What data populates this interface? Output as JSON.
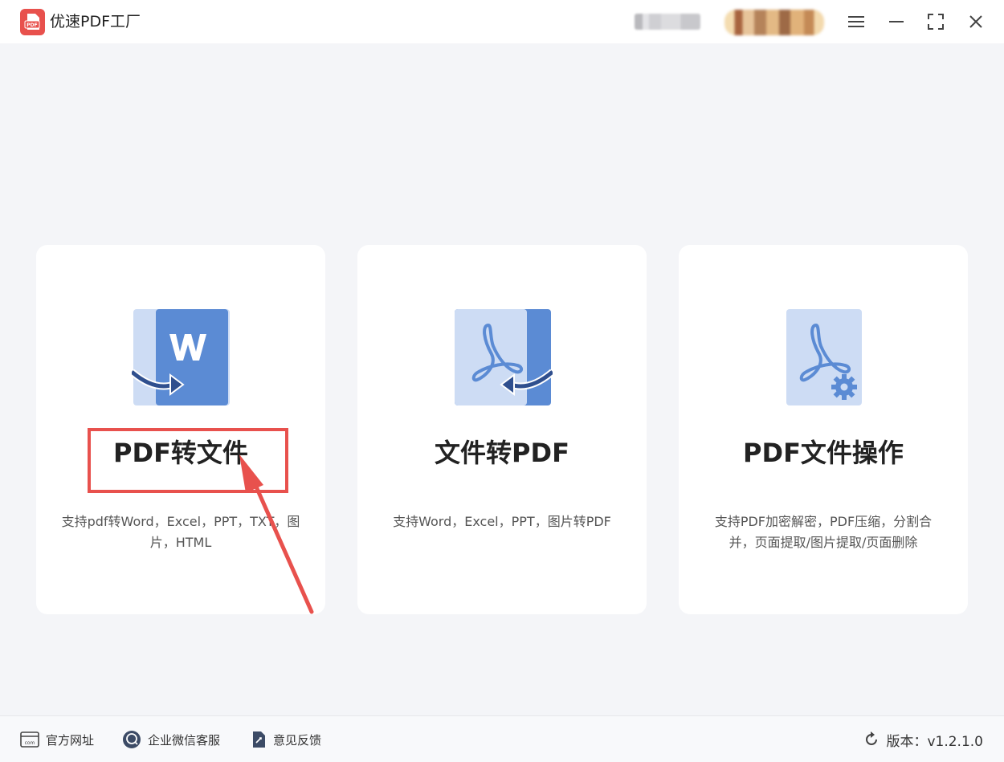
{
  "app": {
    "title": "优速PDF工厂",
    "logo_text": "PDF"
  },
  "cards": [
    {
      "title": "PDF转文件",
      "description": "支持pdf转Word，Excel，PPT，TXT，图片，HTML",
      "icon": "word-convert-icon"
    },
    {
      "title": "文件转PDF",
      "description": "支持Word，Excel，PPT，图片转PDF",
      "icon": "pdf-convert-icon"
    },
    {
      "title": "PDF文件操作",
      "description": "支持PDF加密解密，PDF压缩，分割合并，页面提取/图片提取/页面删除",
      "icon": "pdf-settings-icon"
    }
  ],
  "footer": {
    "website_label": "官方网址",
    "website_icon_text": "com",
    "wechat_label": "企业微信客服",
    "feedback_label": "意见反馈",
    "version_label": "版本：v1.2.1.0"
  },
  "colors": {
    "brand_red": "#e8514d",
    "icon_blue": "#5b8bd4",
    "icon_light_blue": "#cddcf4",
    "arrow_navy": "#2f4f8e"
  }
}
